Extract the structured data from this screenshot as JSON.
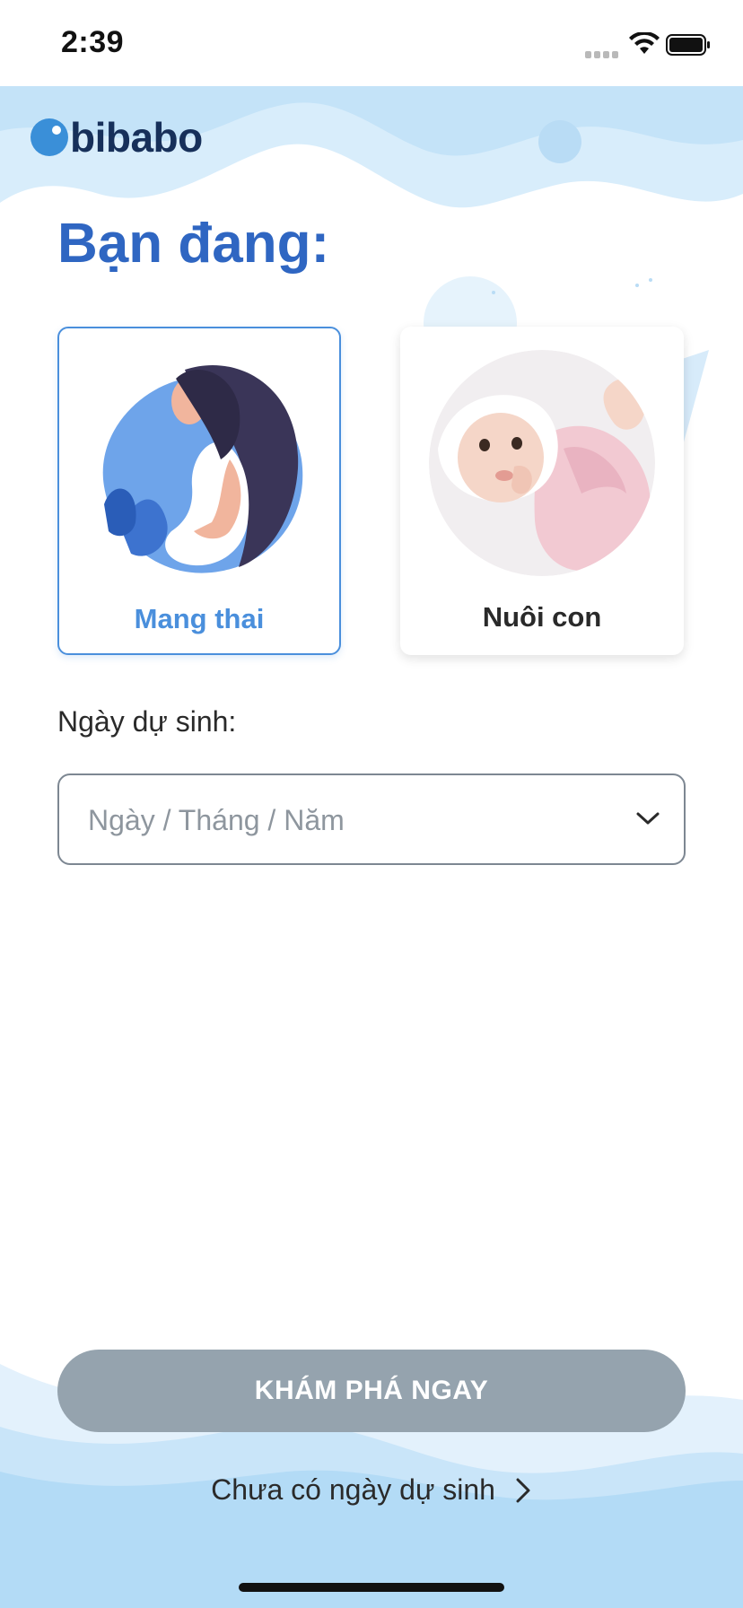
{
  "status_bar": {
    "time": "2:39",
    "icons": [
      "signal-icon",
      "wifi-icon",
      "battery-icon"
    ]
  },
  "logo": {
    "text": "bibabo"
  },
  "heading": "Bạn đang:",
  "options": [
    {
      "label": "Mang thai",
      "selected": true,
      "image": "pregnant-woman-illustration"
    },
    {
      "label": "Nuôi con",
      "selected": false,
      "image": "baby-photo"
    }
  ],
  "due_date": {
    "label": "Ngày dự sinh:",
    "placeholder": "Ngày / Tháng / Năm",
    "icon": "chevron-down-icon"
  },
  "cta": {
    "label": "KHÁM PHÁ NGAY"
  },
  "no_date_link": {
    "label": "Chưa có ngày dự sinh",
    "icon": "chevron-right-icon"
  },
  "colors": {
    "primary_blue": "#2f66c2",
    "selected_border": "#4a8fdc",
    "cta_disabled": "#95a3ae",
    "wave_light": "#d6ecfb",
    "wave_mid": "#b7dcf6"
  }
}
